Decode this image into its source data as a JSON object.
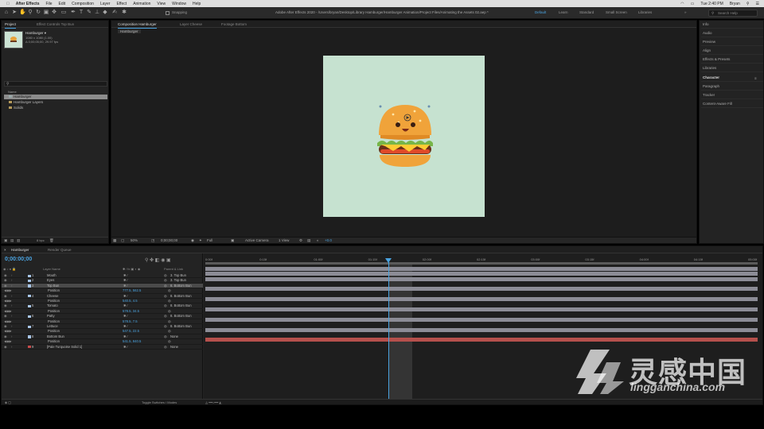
{
  "menubar": {
    "app_name": "After Effects",
    "items": [
      "File",
      "Edit",
      "Composition",
      "Layer",
      "Effect",
      "Animation",
      "View",
      "Window",
      "Help"
    ],
    "clock": "Tue 2:40 PM",
    "user": "Bryan"
  },
  "toolbar": {
    "snapping_label": "Snapping",
    "window_title": "Adobe After Effects 2020 - /Users/bryan/Desktop/Library Hamburger/Hamburger Animation/Project Files/Animating the Assets 02.aep *",
    "workspaces": [
      "Default",
      "Learn",
      "Standard",
      "Small Screen",
      "Libraries"
    ],
    "search_placeholder": "Search Help"
  },
  "project_panel": {
    "tabs": [
      "Project",
      "Effect Controls Top Bun"
    ],
    "item_name": "Hamburger ▾",
    "item_size": "1080 x 1080 (1.00)",
    "item_duration": "Δ 0;00;05;00, 29.97 fps",
    "column_name": "Name",
    "items": [
      {
        "label": "Hamburger",
        "selected": true
      },
      {
        "label": "Hamburger Layers",
        "selected": false
      },
      {
        "label": "Solids",
        "selected": false
      }
    ],
    "bpc": "8 bpc"
  },
  "comp_panel": {
    "tabs": [
      "Composition Hamburger",
      "Layer Cheese",
      "Footage Bottom"
    ],
    "breadcrumb": "Hamburger",
    "footer": {
      "zoom": "50%",
      "timecode": "0;00;00;00",
      "resolution": "Full",
      "camera": "Active Camera",
      "views": "1 View",
      "exposure": "+0.0"
    }
  },
  "right_panel": {
    "items": [
      "Info",
      "Audio",
      "Preview",
      "Align",
      "Effects & Presets",
      "Libraries",
      "Character",
      "Paragraph",
      "Tracker",
      "Content-Aware Fill"
    ]
  },
  "timeline": {
    "tabs": [
      "Hamburger",
      "Render Queue"
    ],
    "timecode": "0;00:00;00",
    "col_layer_name": "Layer Name",
    "col_parent": "Parent & Link",
    "ruler_ticks": [
      "0:00f",
      "0:15f",
      "01:00f",
      "01:15f",
      "02:00f",
      "02:15f",
      "03:00f",
      "03:15f",
      "04:00f",
      "04:15f",
      "05:00f"
    ],
    "layers": [
      {
        "num": "1",
        "name": "Mouth",
        "parent": "3. Top Bun",
        "color": "#a8c6e8",
        "selected": false
      },
      {
        "num": "2",
        "name": "Eyes",
        "parent": "3. Top Bun",
        "color": "#a8c6e8",
        "selected": false
      },
      {
        "num": "3",
        "name": "Top Bun",
        "parent": "8. Bottom Bun",
        "color": "#a8c6e8",
        "selected": true
      },
      {
        "prop": "Position",
        "value": "777.5, 562.5"
      },
      {
        "num": "4",
        "name": "Cheese",
        "parent": "8. Bottom Bun",
        "color": "#a8c6e8",
        "selected": false
      },
      {
        "prop": "Position",
        "value": "540.5, 4.5"
      },
      {
        "num": "5",
        "name": "Tomato",
        "parent": "8. Bottom Bun",
        "color": "#a8c6e8",
        "selected": false
      },
      {
        "prop": "Position",
        "value": "578.5, 34.5"
      },
      {
        "num": "6",
        "name": "Patty",
        "parent": "8. Bottom Bun",
        "color": "#a8c6e8",
        "selected": false
      },
      {
        "prop": "Position",
        "value": "578.5, 7.5"
      },
      {
        "num": "7",
        "name": "Lettuce",
        "parent": "8. Bottom Bun",
        "color": "#a8c6e8",
        "selected": false
      },
      {
        "prop": "Position",
        "value": "547.5, 22.5"
      },
      {
        "num": "8",
        "name": "Bottom Bun",
        "parent": "None",
        "color": "#a8c6e8",
        "selected": false
      },
      {
        "prop": "Position",
        "value": "541.5, 840.5"
      },
      {
        "num": "9",
        "name": "[Pale Turquoise Solid 1]",
        "parent": "None",
        "color": "#c74b4b",
        "selected": false
      }
    ],
    "footer_label": "Toggle Switches / Modes"
  },
  "watermark": {
    "brand_cn": "灵感中国",
    "url": "lingganchina.com"
  },
  "colors": {
    "accent_blue": "#4aa3e0",
    "canvas_bg": "#c6e2d0",
    "layer_bar": "#8c8c96",
    "solid_bar": "#b5504c"
  }
}
